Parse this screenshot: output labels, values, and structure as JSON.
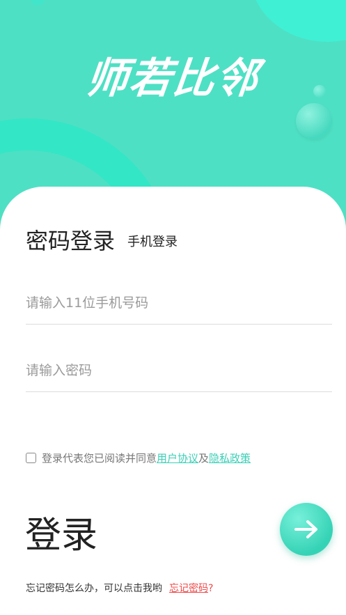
{
  "header": {
    "app_name": "师若比邻"
  },
  "tabs": {
    "password_login": "密码登录",
    "phone_login": "手机登录"
  },
  "form": {
    "phone_placeholder": "请输入11位手机号码",
    "password_placeholder": "请输入密码"
  },
  "agreement": {
    "prefix": "登录代表您已阅读并同意",
    "user_agreement": "用户协议",
    "and": "及",
    "privacy_policy": "隐私政策",
    "checked": false
  },
  "login": {
    "label": "登录",
    "go_icon": "arrow-right-icon"
  },
  "forgot": {
    "hint": "忘记密码怎么办，可以点击我哟",
    "link": "忘记密码",
    "suffix": "?"
  },
  "colors": {
    "brand": "#4ee0c4",
    "link": "#3ccfb6",
    "danger": "#f04848"
  }
}
